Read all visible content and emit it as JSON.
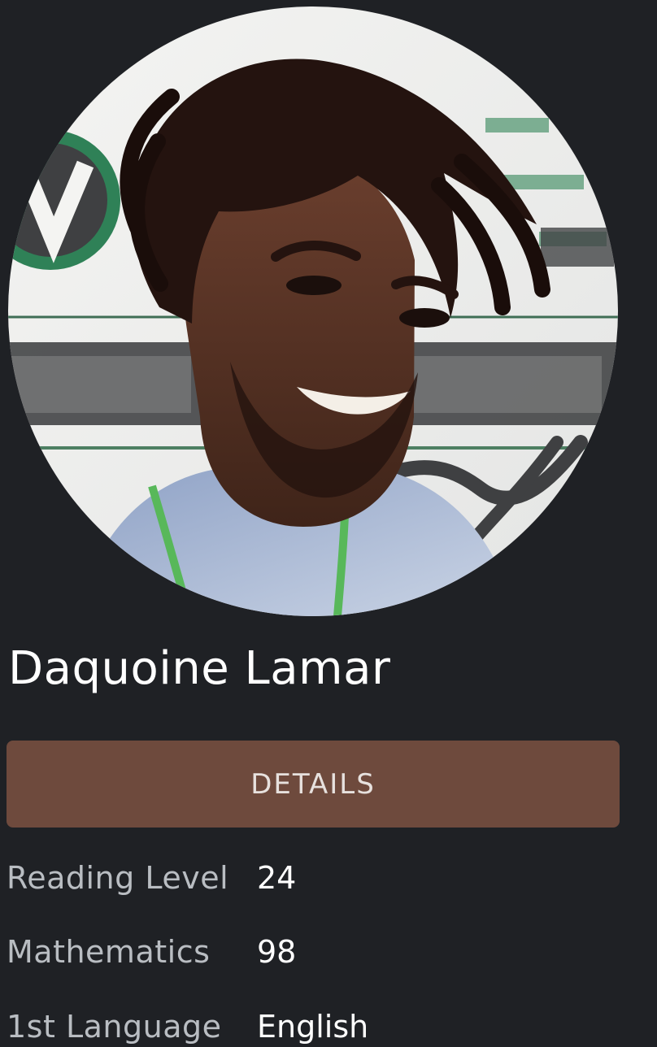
{
  "profile": {
    "name": "Daquoine Lamar",
    "photo_icon": "person-photo"
  },
  "actions": {
    "details_label": "DETAILS"
  },
  "stats": [
    {
      "label": "Reading Level",
      "value": "24"
    },
    {
      "label": "Mathematics",
      "value": "98"
    },
    {
      "label": "1st Language",
      "value": "English"
    }
  ],
  "colors": {
    "background": "#1f2125",
    "button": "#6e4a3d",
    "text": "#ffffff",
    "muted": "#b9bdc2"
  }
}
